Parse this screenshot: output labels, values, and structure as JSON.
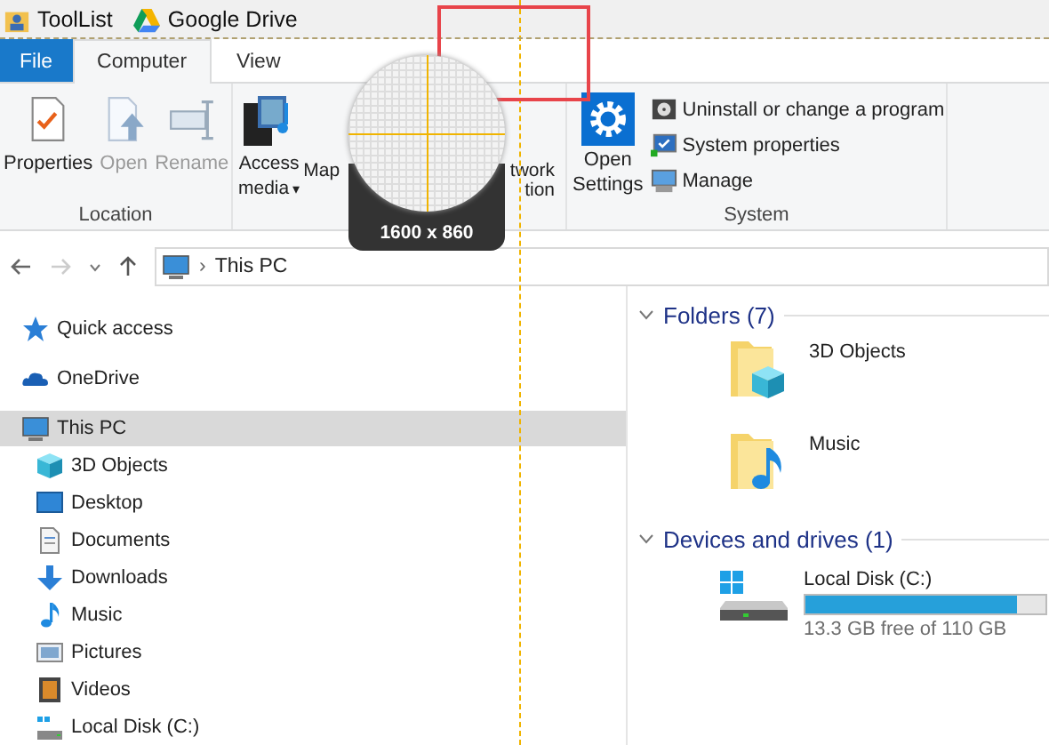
{
  "title_bar": {
    "items": [
      {
        "label": "ToolList"
      },
      {
        "label": "Google Drive"
      }
    ]
  },
  "tabs": [
    {
      "label": "File",
      "kind": "file",
      "selected": false
    },
    {
      "label": "Computer",
      "kind": "tab",
      "selected": true
    },
    {
      "label": "View",
      "kind": "tab",
      "selected": false
    }
  ],
  "ribbon": {
    "location": {
      "label": "Location",
      "buttons": [
        {
          "label": "Properties",
          "disabled": false
        },
        {
          "label": "Open",
          "disabled": true
        },
        {
          "label": "Rename",
          "disabled": true
        }
      ]
    },
    "network": {
      "buttons": [
        {
          "lines": [
            "Access",
            "media"
          ],
          "dropdown": "▾"
        },
        {
          "lines": [
            "Map"
          ]
        },
        {
          "lines": [
            "twork",
            "tion"
          ]
        }
      ]
    },
    "system": {
      "label": "System",
      "open_settings": {
        "lines": [
          "Open",
          "Settings"
        ]
      },
      "items": [
        {
          "label": "Uninstall or change a program"
        },
        {
          "label": "System properties"
        },
        {
          "label": "Manage"
        }
      ]
    }
  },
  "magnifier": {
    "size": "1600 x 860"
  },
  "address_bar": {
    "separator": "›",
    "path": "This PC"
  },
  "nav_pane": {
    "items": [
      {
        "label": "Quick access",
        "selected": false
      },
      {
        "label": "OneDrive",
        "selected": false
      },
      {
        "label": "This PC",
        "selected": true,
        "children": [
          {
            "label": "3D Objects",
            "selected": false
          },
          {
            "label": "Desktop",
            "selected": false
          },
          {
            "label": "Documents",
            "selected": false
          },
          {
            "label": "Downloads",
            "selected": false
          },
          {
            "label": "Music",
            "selected": false
          },
          {
            "label": "Pictures",
            "selected": false
          },
          {
            "label": "Videos",
            "selected": false
          },
          {
            "label": "Local Disk (C:)",
            "selected": false
          }
        ]
      }
    ]
  },
  "content": {
    "folders": {
      "title": "Folders (7)",
      "items": [
        {
          "label": "3D Objects"
        },
        {
          "label": "Music"
        }
      ]
    },
    "drives": {
      "title": "Devices and drives (1)",
      "items": [
        {
          "label": "Local Disk (C:)",
          "level": 0.88,
          "free": "13.3 GB free of 110 GB"
        }
      ]
    }
  }
}
